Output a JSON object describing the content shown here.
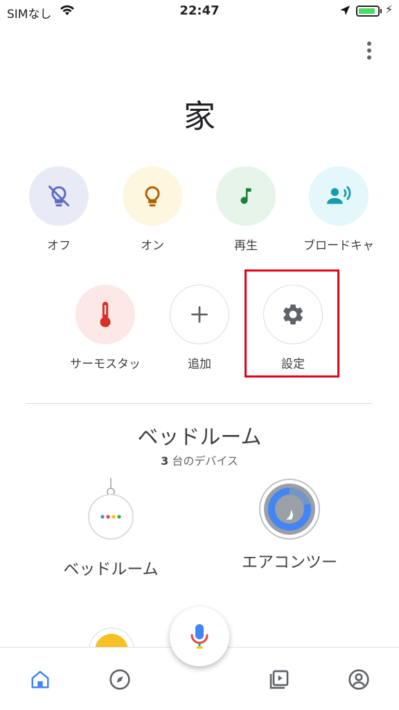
{
  "status_bar": {
    "carrier": "SIMなし",
    "time": "22:47",
    "battery_percent": 90
  },
  "home": {
    "title": "家"
  },
  "actions": [
    {
      "label": "オフ",
      "icon": "light-off-icon"
    },
    {
      "label": "オン",
      "icon": "light-on-icon"
    },
    {
      "label": "再生",
      "icon": "music-note-icon"
    },
    {
      "label": "ブロードキャ",
      "icon": "broadcast-icon"
    },
    {
      "label": "サーモスタッ",
      "icon": "thermometer-icon"
    },
    {
      "label": "追加",
      "icon": "plus-icon"
    },
    {
      "label": "設定",
      "icon": "gear-icon"
    }
  ],
  "room": {
    "name": "ベッドルーム",
    "count_number": "3",
    "count_text": "台のデバイス",
    "devices": [
      {
        "label": "ベッドルーム",
        "icon": "smart-speaker-icon"
      },
      {
        "label": "エアコンツー",
        "icon": "thermostat-dial-icon"
      }
    ]
  },
  "bottom_nav": [
    "home-icon",
    "compass-icon",
    "mic-icon",
    "media-icon",
    "account-icon"
  ],
  "colors": {
    "highlight": "#e3001b",
    "accent": "#4285f4"
  }
}
